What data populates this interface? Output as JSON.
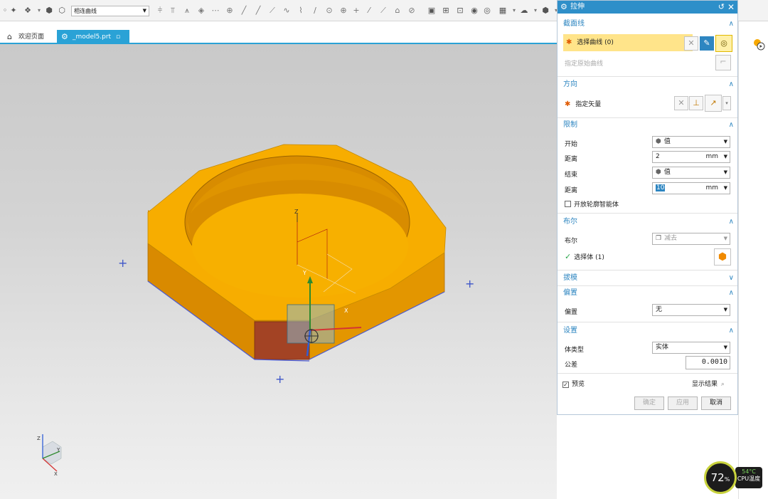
{
  "toolbar": {
    "filter": "相连曲线"
  },
  "tabs": [
    {
      "label": "欢迎页面",
      "icon": "home-icon"
    },
    {
      "label": "_model5.prt",
      "icon": "part-file-icon"
    }
  ],
  "dialog": {
    "title": "拉伸",
    "sections": {
      "section_curve": {
        "title": "截面线",
        "select_curve": "选择曲线 (0)",
        "specify_origin_curve": "指定原始曲线"
      },
      "direction": {
        "title": "方向",
        "specify_vector": "指定矢量"
      },
      "limits": {
        "title": "限制",
        "start_label": "开始",
        "start_value": "值",
        "distance1_label": "距离",
        "distance1_value": "2",
        "distance1_unit": "mm",
        "end_label": "结束",
        "end_value": "值",
        "distance2_label": "距离",
        "distance2_value": "10",
        "distance2_unit": "mm",
        "open_profile": "开放轮廓智能体"
      },
      "boolean": {
        "title": "布尔",
        "boolean_label": "布尔",
        "boolean_value": "减去",
        "select_body": "选择体 (1)"
      },
      "draft": {
        "title": "拔模"
      },
      "offset": {
        "title": "偏置",
        "offset_label": "偏置",
        "offset_value": "无"
      },
      "settings": {
        "title": "设置",
        "body_type_label": "体类型",
        "body_type_value": "实体",
        "tolerance_label": "公差",
        "tolerance_value": "0.0010"
      }
    },
    "preview_label": "预览",
    "show_result": "显示结果",
    "buttons": {
      "ok": "确定",
      "apply": "应用",
      "cancel": "取消"
    }
  },
  "viewport": {
    "axis_labels": {
      "z": "Z",
      "y": "Y",
      "x": "X"
    },
    "triad_labels": {
      "z": "Z",
      "y": "Y",
      "x": "X"
    },
    "model_color": "#f7a800"
  },
  "cpu": {
    "usage": "72",
    "unit": "%",
    "temp": "54°C",
    "label": "CPU温度"
  },
  "colors": {
    "accent": "#2e8fc9",
    "highlight": "#ffe48a",
    "model": "#f7a800"
  }
}
